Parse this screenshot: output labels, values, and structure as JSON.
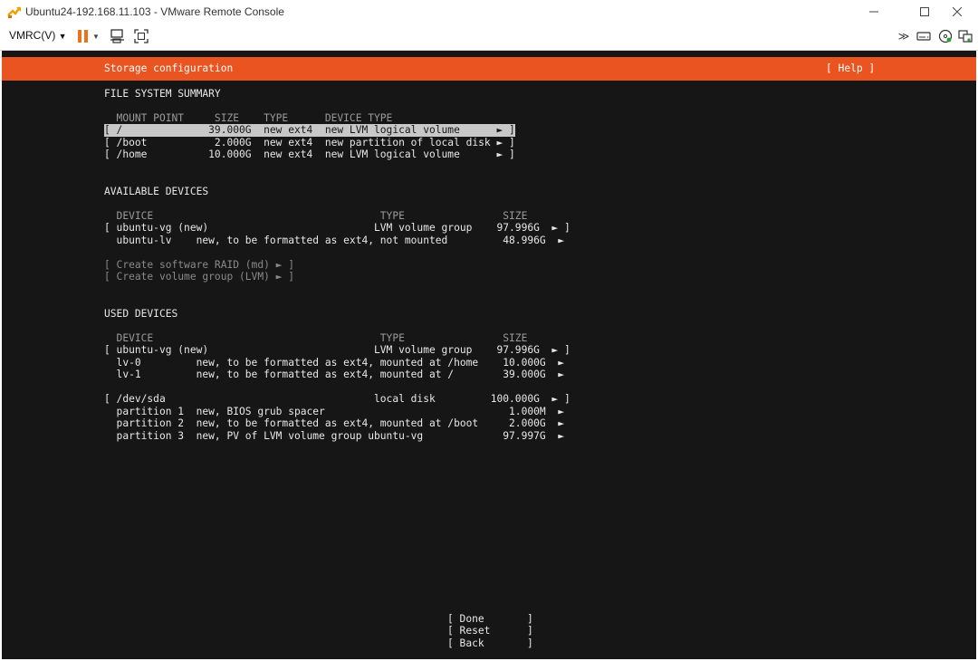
{
  "window": {
    "title": "Ubuntu24-192.168.11.103 - VMware Remote Console",
    "controls": [
      "minimize",
      "maximize",
      "close"
    ]
  },
  "toolbar": {
    "menu_label": "VMRC(V)",
    "left_icons": [
      "pause-icon",
      "send-keys-icon",
      "fullscreen-icon"
    ],
    "right_icons": [
      "more-icon",
      "removable-device-icon",
      "cd-icon",
      "unity-icon"
    ]
  },
  "installer": {
    "header_title": "Storage configuration",
    "help_label": "[ Help ]",
    "fs_summary": {
      "title": "FILE SYSTEM SUMMARY",
      "header": "  MOUNT POINT     SIZE    TYPE      DEVICE TYPE",
      "rows": [
        "[ /              39.000G  new ext4  new LVM logical volume      ► ]",
        "[ /boot           2.000G  new ext4  new partition of local disk ► ]",
        "[ /home          10.000G  new ext4  new LVM logical volume      ► ]"
      ]
    },
    "available": {
      "title": "AVAILABLE DEVICES",
      "header": "  DEVICE                                     TYPE                SIZE",
      "rows": [
        "[ ubuntu-vg (new)                           LVM volume group    97.996G  ► ]",
        "  ubuntu-lv    new, to be formatted as ext4, not mounted         48.996G  ►"
      ],
      "actions": [
        "[ Create software RAID (md) ► ]",
        "[ Create volume group (LVM) ► ]"
      ]
    },
    "used": {
      "title": "USED DEVICES",
      "header": "  DEVICE                                     TYPE                SIZE",
      "rows": [
        "[ ubuntu-vg (new)                           LVM volume group    97.996G  ► ]",
        "  lv-0         new, to be formatted as ext4, mounted at /home    10.000G  ►",
        "  lv-1         new, to be formatted as ext4, mounted at /        39.000G  ►",
        "",
        "[ /dev/sda                                  local disk         100.000G  ► ]",
        "  partition 1  new, BIOS grub spacer                              1.000M  ►",
        "  partition 2  new, to be formatted as ext4, mounted at /boot     2.000G  ►",
        "  partition 3  new, PV of LVM volume group ubuntu-vg             97.997G  ►"
      ]
    },
    "buttons": [
      "[ Done       ]",
      "[ Reset      ]",
      "[ Back       ]"
    ]
  }
}
